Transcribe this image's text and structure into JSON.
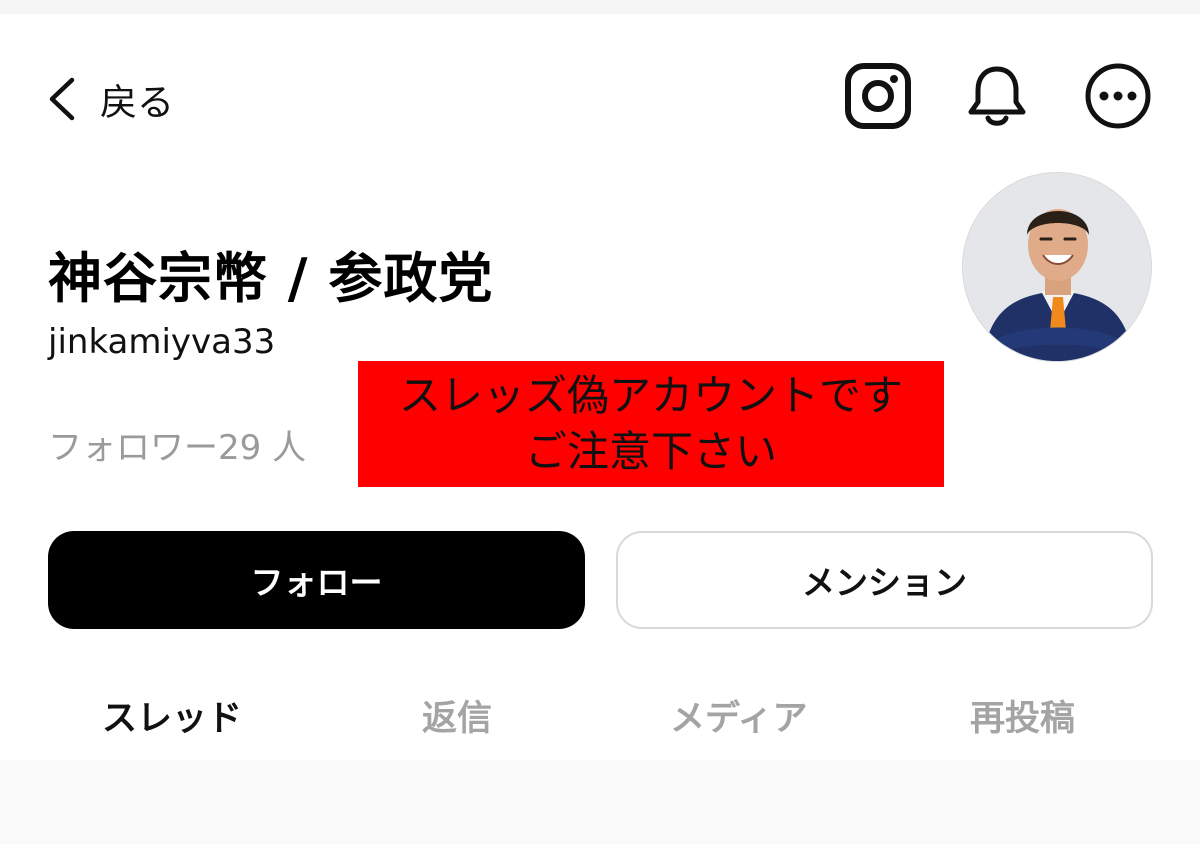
{
  "header": {
    "back_label": "戻る",
    "icons": [
      "chevron-left-icon",
      "instagram-icon",
      "bell-icon",
      "more-icon"
    ]
  },
  "profile": {
    "name": "神谷宗幣 / 参政党",
    "handle": "jinkamiyva33",
    "followers": "フォロワー29 人"
  },
  "warning": {
    "line1": "スレッズ偽アカウントです",
    "line2": "ご注意下さい",
    "background": "#ff0000"
  },
  "actions": {
    "follow_label": "フォロー",
    "mention_label": "メンション"
  },
  "tabs": [
    {
      "label": "スレッド",
      "active": true
    },
    {
      "label": "返信",
      "active": false
    },
    {
      "label": "メディア",
      "active": false
    },
    {
      "label": "再投稿",
      "active": false
    }
  ],
  "colors": {
    "primary": "#000000",
    "muted_text": "#9a9a9a",
    "warning": "#ff0000"
  }
}
